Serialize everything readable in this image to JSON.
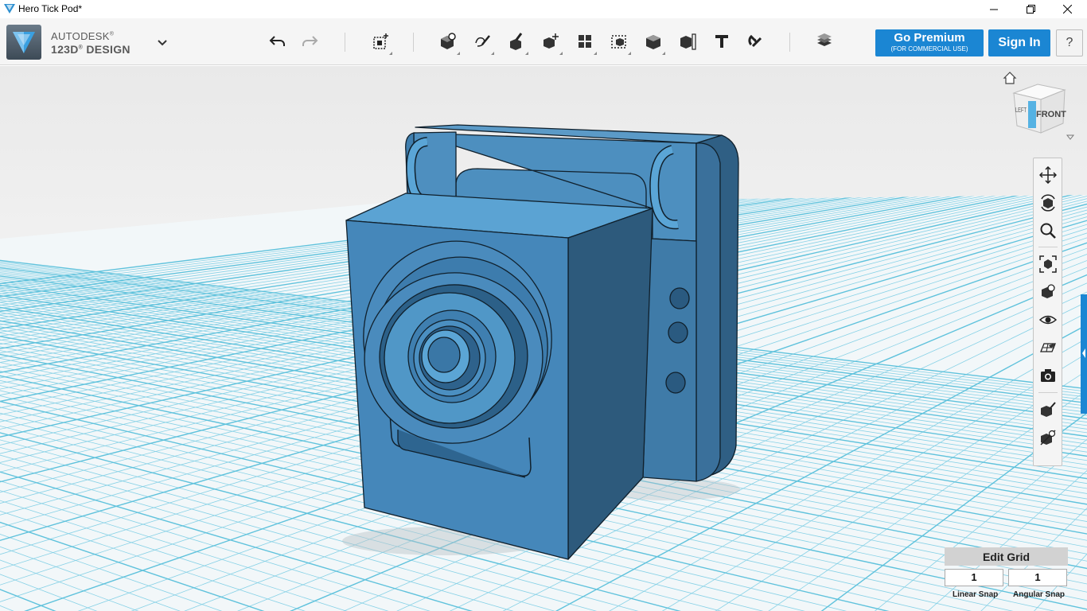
{
  "window": {
    "title": "Hero Tick Pod*"
  },
  "brand": {
    "line1": "AUTODESK",
    "line1_mark": "®",
    "line2": "123D",
    "line2_mark": "®",
    "line2_rest": " DESIGN"
  },
  "toolbar": {
    "icons": [
      "undo-icon",
      "redo-icon",
      "primitives-icon",
      "sketch-icon",
      "construct-icon",
      "modify-icon",
      "transform-icon",
      "pattern-icon",
      "grouping-icon",
      "combine-icon",
      "measure-icon",
      "material-icon",
      "text-icon",
      "snap-icon",
      "layers-icon"
    ]
  },
  "account": {
    "premium_label": "Go Premium",
    "premium_sub": "(FOR COMMERCIAL USE)",
    "signin_label": "Sign In",
    "help_label": "?"
  },
  "viewcube": {
    "front_label": "FRONT",
    "left_label": "LEFT"
  },
  "navbar": {
    "icons": [
      "pan-icon",
      "orbit-icon",
      "zoom-icon",
      "fit-icon",
      "view-mode-icon",
      "visibility-icon",
      "grid-view-icon",
      "camera-icon",
      "material-display-icon",
      "outline-display-icon"
    ]
  },
  "grid": {
    "edit_label": "Edit Grid",
    "linear_value": "1",
    "angular_value": "1",
    "linear_label": "Linear Snap",
    "angular_label": "Angular Snap"
  },
  "colors": {
    "model": "#4a8bbd",
    "accent": "#1b86d3",
    "grid_line": "#7fd0e6"
  }
}
